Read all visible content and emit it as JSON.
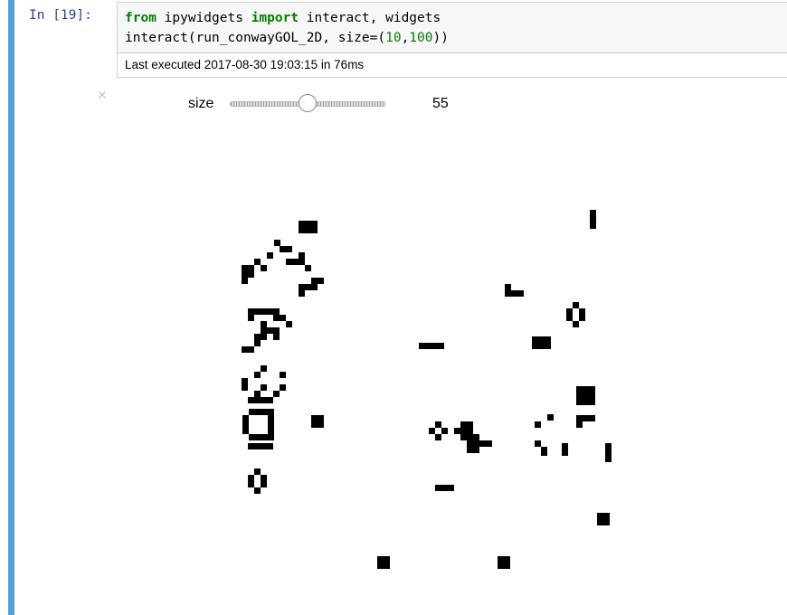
{
  "cell": {
    "prompt": "In [19]:",
    "code": {
      "line1": {
        "kw1": "from",
        "mid": " ipywidgets ",
        "kw2": "import",
        "rest": " interact, widgets"
      },
      "line2": {
        "pre": "interact(run_conwayGOL_2D, size=(",
        "n1": "10",
        "comma": ",",
        "n2": "100",
        "post": "))"
      }
    },
    "exec_info": "Last executed 2017-08-30 19:03:15 in 76ms"
  },
  "widget": {
    "close_icon": "close-icon",
    "slider": {
      "label": "size",
      "min": 10,
      "max": 100,
      "value": "55"
    }
  },
  "colors": {
    "prompt": "#303f9f",
    "cell_border": "#5a9fd4",
    "keyword": "#008000",
    "live_cell": "#000000"
  },
  "gol": {
    "live_cells": [
      [
        330,
        244
      ],
      [
        337,
        244
      ],
      [
        344,
        244
      ],
      [
        330,
        251
      ],
      [
        337,
        251
      ],
      [
        344,
        251
      ],
      [
        652,
        232
      ],
      [
        652,
        239
      ],
      [
        652,
        246
      ],
      [
        303,
        265
      ],
      [
        309,
        272
      ],
      [
        316,
        272
      ],
      [
        295,
        279
      ],
      [
        330,
        279
      ],
      [
        281,
        286
      ],
      [
        316,
        286
      ],
      [
        323,
        286
      ],
      [
        330,
        286
      ],
      [
        267,
        293
      ],
      [
        274,
        293
      ],
      [
        288,
        293
      ],
      [
        337,
        293
      ],
      [
        267,
        300
      ],
      [
        274,
        300
      ],
      [
        267,
        307
      ],
      [
        344,
        307
      ],
      [
        351,
        307
      ],
      [
        330,
        314
      ],
      [
        337,
        314
      ],
      [
        344,
        314
      ],
      [
        330,
        321
      ],
      [
        558,
        314
      ],
      [
        558,
        321
      ],
      [
        565,
        321
      ],
      [
        572,
        321
      ],
      [
        633,
        334
      ],
      [
        626,
        341
      ],
      [
        640,
        341
      ],
      [
        626,
        348
      ],
      [
        640,
        348
      ],
      [
        633,
        355
      ],
      [
        274,
        341
      ],
      [
        281,
        341
      ],
      [
        288,
        341
      ],
      [
        295,
        341
      ],
      [
        302,
        341
      ],
      [
        274,
        348
      ],
      [
        302,
        348
      ],
      [
        309,
        348
      ],
      [
        288,
        355
      ],
      [
        316,
        355
      ],
      [
        288,
        362
      ],
      [
        295,
        362
      ],
      [
        302,
        362
      ],
      [
        281,
        369
      ],
      [
        288,
        369
      ],
      [
        302,
        369
      ],
      [
        281,
        376
      ],
      [
        267,
        383
      ],
      [
        274,
        383
      ],
      [
        588,
        372
      ],
      [
        595,
        372
      ],
      [
        602,
        372
      ],
      [
        588,
        379
      ],
      [
        595,
        379
      ],
      [
        602,
        379
      ],
      [
        463,
        379
      ],
      [
        470,
        379
      ],
      [
        477,
        379
      ],
      [
        484,
        379
      ],
      [
        288,
        404
      ],
      [
        281,
        411
      ],
      [
        267,
        418
      ],
      [
        309,
        411
      ],
      [
        267,
        425
      ],
      [
        309,
        425
      ],
      [
        288,
        425
      ],
      [
        281,
        432
      ],
      [
        302,
        432
      ],
      [
        274,
        439
      ],
      [
        281,
        439
      ],
      [
        288,
        439
      ],
      [
        295,
        439
      ],
      [
        637,
        427
      ],
      [
        644,
        427
      ],
      [
        651,
        427
      ],
      [
        637,
        434
      ],
      [
        644,
        434
      ],
      [
        651,
        434
      ],
      [
        637,
        441
      ],
      [
        644,
        441
      ],
      [
        651,
        441
      ],
      [
        344,
        459
      ],
      [
        351,
        459
      ],
      [
        344,
        466
      ],
      [
        351,
        466
      ],
      [
        275,
        452
      ],
      [
        282,
        452
      ],
      [
        289,
        452
      ],
      [
        296,
        452
      ],
      [
        268,
        459
      ],
      [
        268,
        466
      ],
      [
        268,
        473
      ],
      [
        296,
        459
      ],
      [
        296,
        466
      ],
      [
        296,
        473
      ],
      [
        275,
        480
      ],
      [
        282,
        480
      ],
      [
        289,
        480
      ],
      [
        296,
        480
      ],
      [
        605,
        458
      ],
      [
        637,
        459
      ],
      [
        644,
        459
      ],
      [
        651,
        459
      ],
      [
        637,
        466
      ],
      [
        481,
        466
      ],
      [
        474,
        473
      ],
      [
        488,
        473
      ],
      [
        481,
        480
      ],
      [
        509,
        466
      ],
      [
        516,
        466
      ],
      [
        502,
        473
      ],
      [
        509,
        473
      ],
      [
        516,
        473
      ],
      [
        509,
        480
      ],
      [
        516,
        480
      ],
      [
        523,
        480
      ],
      [
        516,
        487
      ],
      [
        523,
        487
      ],
      [
        530,
        487
      ],
      [
        537,
        487
      ],
      [
        516,
        494
      ],
      [
        523,
        494
      ],
      [
        591,
        466
      ],
      [
        591,
        487
      ],
      [
        598,
        494
      ],
      [
        598,
        497
      ],
      [
        274,
        490
      ],
      [
        281,
        490
      ],
      [
        288,
        490
      ],
      [
        295,
        490
      ],
      [
        621,
        490
      ],
      [
        621,
        497
      ],
      [
        669,
        490
      ],
      [
        669,
        497
      ],
      [
        669,
        504
      ],
      [
        281,
        518
      ],
      [
        274,
        525
      ],
      [
        288,
        525
      ],
      [
        274,
        532
      ],
      [
        288,
        532
      ],
      [
        281,
        539
      ],
      [
        481,
        536
      ],
      [
        488,
        536
      ],
      [
        495,
        536
      ],
      [
        660,
        567
      ],
      [
        667,
        567
      ],
      [
        660,
        574
      ],
      [
        667,
        574
      ],
      [
        417,
        615
      ],
      [
        424,
        615
      ],
      [
        417,
        622
      ],
      [
        424,
        622
      ],
      [
        550,
        615
      ],
      [
        557,
        615
      ],
      [
        550,
        622
      ],
      [
        557,
        622
      ]
    ]
  }
}
